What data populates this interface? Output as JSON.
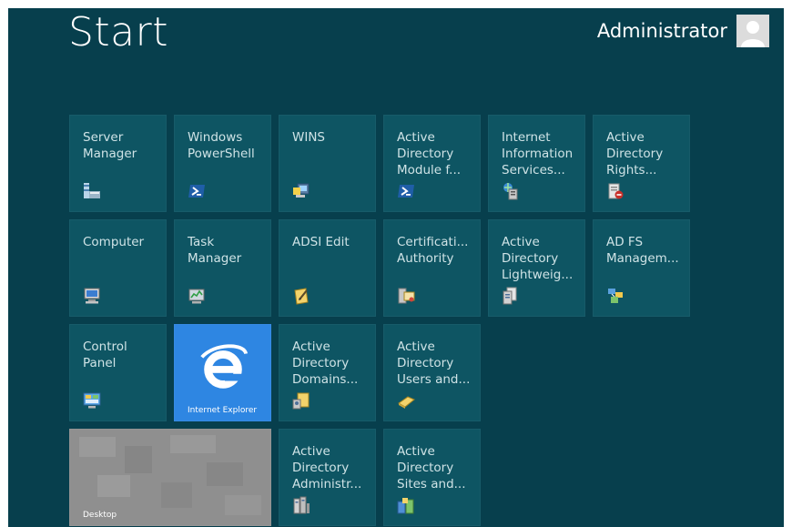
{
  "header": {
    "title": "Start",
    "user_name": "Administrator"
  },
  "colors": {
    "background": "#073f4d",
    "tile": "#0e5563",
    "ie_tile": "#2e86e2",
    "desktop_tile": "#8f8f8f"
  },
  "tiles": [
    {
      "label": "Server\nManager",
      "icon": "server-manager-icon"
    },
    {
      "label": "Windows\nPowerShell",
      "icon": "powershell-icon"
    },
    {
      "label": "WINS",
      "icon": "wins-icon"
    },
    {
      "label": "Active\nDirectory\nModule f...",
      "icon": "powershell-icon"
    },
    {
      "label": "Internet\nInformation\nServices...",
      "icon": "iis-icon"
    },
    {
      "label": "Active\nDirectory\nRights...",
      "icon": "rights-management-icon"
    },
    {
      "label": "Computer",
      "icon": "computer-icon"
    },
    {
      "label": "Task\nManager",
      "icon": "task-manager-icon"
    },
    {
      "label": "ADSI Edit",
      "icon": "adsi-edit-icon"
    },
    {
      "label": "Certificati...\nAuthority",
      "icon": "certificate-authority-icon"
    },
    {
      "label": "Active\nDirectory\nLightweig...",
      "icon": "lightweight-directory-icon"
    },
    {
      "label": "AD FS\nManagem...",
      "icon": "adfs-icon"
    },
    {
      "label": "Control\nPanel",
      "icon": "control-panel-icon"
    },
    {
      "label": "Internet Explorer",
      "icon": "internet-explorer-icon"
    },
    {
      "label": "Active\nDirectory\nDomains...",
      "icon": "domains-trusts-icon"
    },
    {
      "label": "Active\nDirectory\nUsers and...",
      "icon": "users-computers-icon"
    },
    {
      "label": "Desktop",
      "icon": "desktop-icon"
    },
    {
      "label": "Active\nDirectory\nAdministr...",
      "icon": "admin-center-icon"
    },
    {
      "label": "Active\nDirectory\nSites and...",
      "icon": "sites-services-icon"
    }
  ]
}
